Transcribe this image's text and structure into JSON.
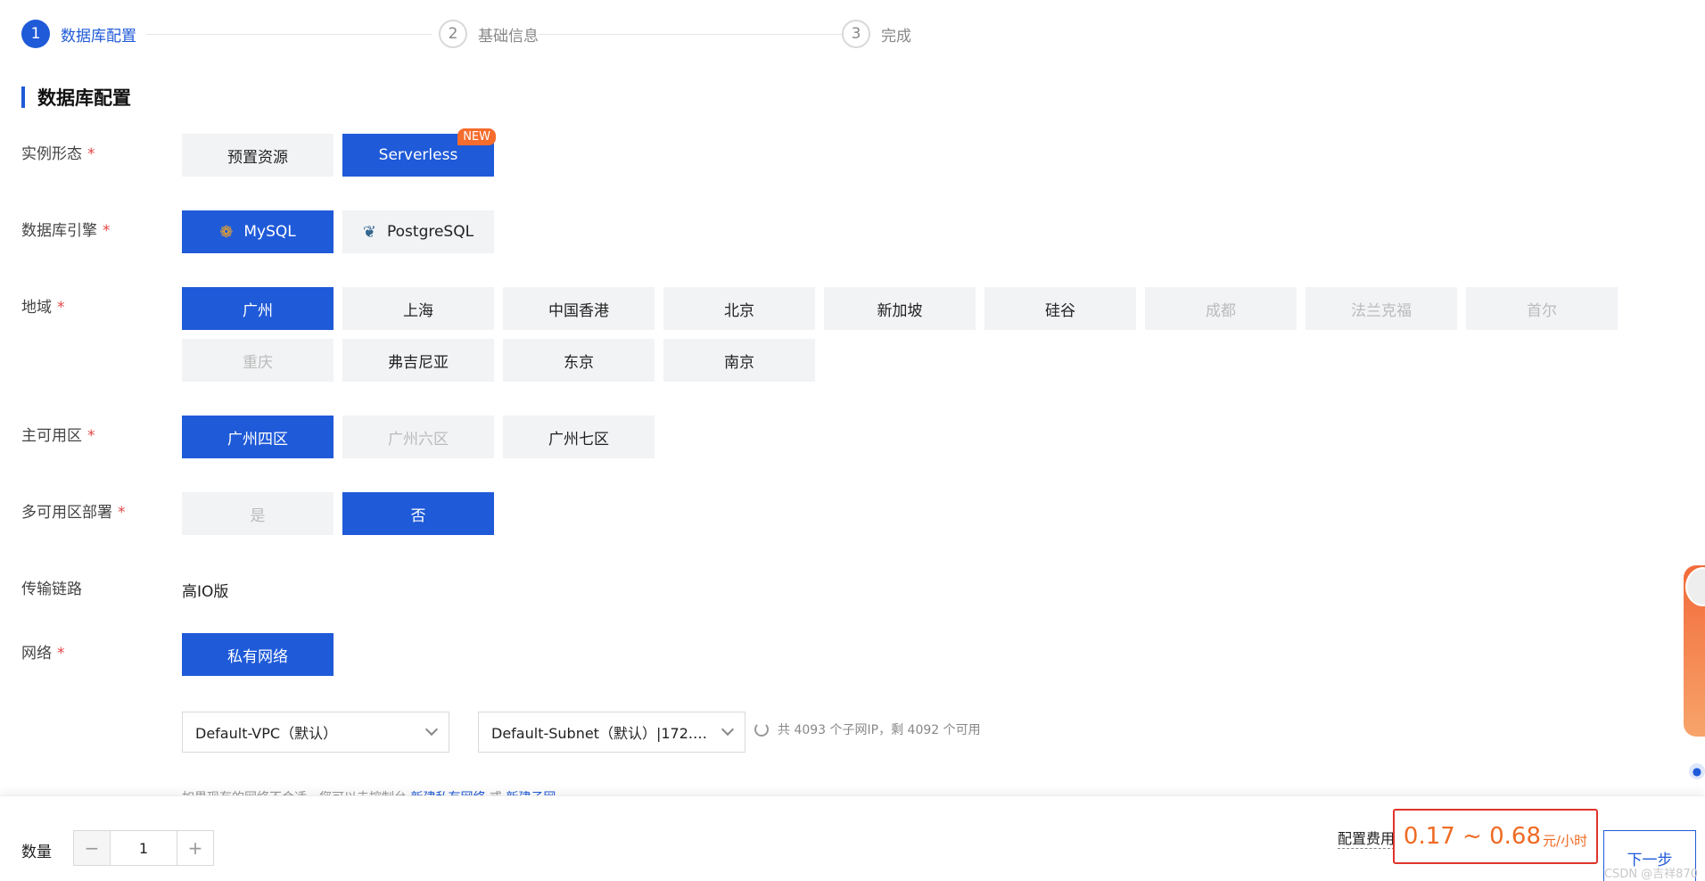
{
  "steps": [
    {
      "num": "1",
      "label": "数据库配置"
    },
    {
      "num": "2",
      "label": "基础信息"
    },
    {
      "num": "3",
      "label": "完成"
    }
  ],
  "section_title": "数据库配置",
  "required_mark": "*",
  "rows": {
    "instance_form": {
      "label": "实例形态",
      "options": [
        "预置资源",
        "Serverless"
      ],
      "selected": "Serverless",
      "badge": "NEW"
    },
    "engine": {
      "label": "数据库引擎",
      "options": [
        "MySQL",
        "PostgreSQL"
      ],
      "selected": "MySQL"
    },
    "region": {
      "label": "地域",
      "options": [
        "广州",
        "上海",
        "中国香港",
        "北京",
        "新加坡",
        "硅谷",
        "成都",
        "法兰克福",
        "首尔",
        "重庆",
        "弗吉尼亚",
        "东京",
        "南京"
      ],
      "selected": "广州",
      "disabled": [
        "成都",
        "法兰克福",
        "首尔",
        "重庆"
      ]
    },
    "zone": {
      "label": "主可用区",
      "options": [
        "广州四区",
        "广州六区",
        "广州七区"
      ],
      "selected": "广州四区",
      "disabled": [
        "广州六区"
      ]
    },
    "multi_az": {
      "label": "多可用区部署",
      "options": [
        "是",
        "否"
      ],
      "selected": "否",
      "disabled": [
        "是"
      ]
    },
    "link": {
      "label": "传输链路",
      "value": "高IO版"
    },
    "network": {
      "label": "网络",
      "options": [
        "私有网络"
      ],
      "selected": "私有网络",
      "vpc": "Default-VPC（默认）",
      "subnet": "Default-Subnet（默认）|172.1...",
      "subnet_info": "共 4093 个子网IP，剩 4092 个可用",
      "hint_prefix": "如果现有的网络不合适，您可以去控制台",
      "hint_link1": "新建私有网络",
      "hint_or": "或",
      "hint_link2": "新建子网"
    }
  },
  "footer": {
    "qty_label": "数量",
    "qty_minus": "−",
    "qty_value": "1",
    "qty_plus": "+",
    "fee_label": "配置费用",
    "fee_value": "0.17 ~ 0.68",
    "fee_unit": "元/小时",
    "next_label": "下一步",
    "watermark": "CSDN @吉祥870"
  },
  "colors": {
    "primary": "#1f5ad8",
    "price": "#f06a23",
    "required": "#e54545",
    "highlight_box": "#e0332b"
  }
}
